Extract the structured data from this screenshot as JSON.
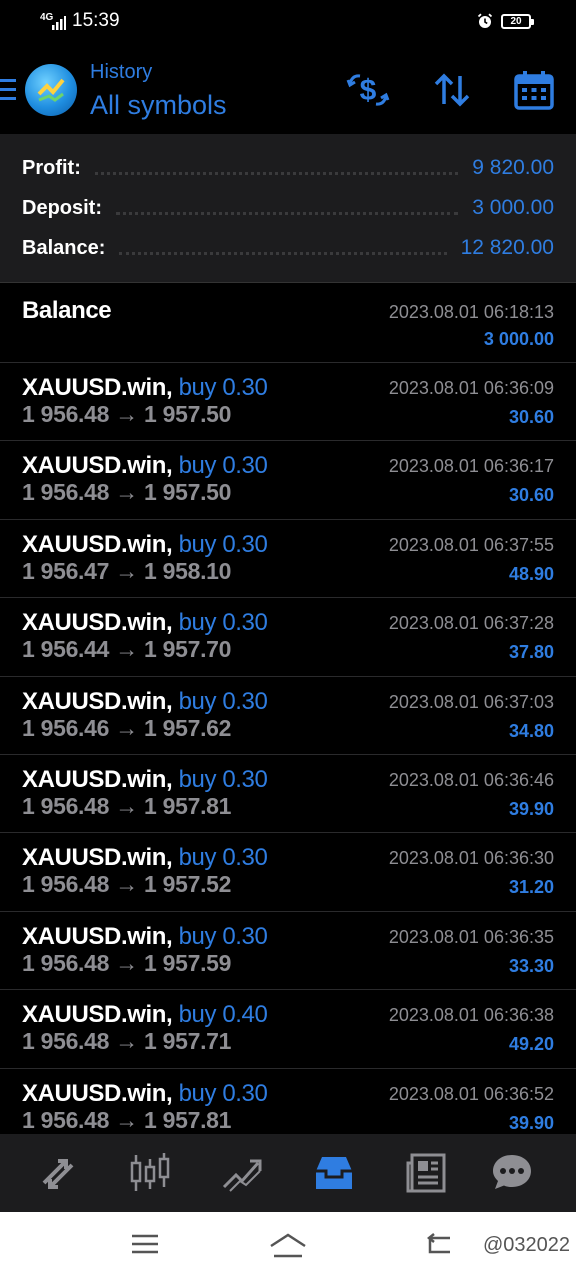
{
  "status_bar": {
    "network": "4G",
    "time": "15:39",
    "battery": "20"
  },
  "header": {
    "subtitle": "History",
    "title": "All symbols",
    "icons": [
      "menu-icon",
      "currency-exchange-icon",
      "sort-icon",
      "calendar-icon"
    ]
  },
  "summary": {
    "profit_label": "Profit:",
    "profit_value": "9 820.00",
    "deposit_label": "Deposit:",
    "deposit_value": "3 000.00",
    "balance_label": "Balance:",
    "balance_value": "12 820.00"
  },
  "balance_entry": {
    "label": "Balance",
    "datetime": "2023.08.01 06:18:13",
    "amount": "3 000.00"
  },
  "trades": [
    {
      "symbol": "XAUUSD.win,",
      "type": "buy 0.30",
      "prices": "1 956.48 → 1 957.50",
      "datetime": "2023.08.01 06:36:09",
      "profit": "30.60"
    },
    {
      "symbol": "XAUUSD.win,",
      "type": "buy 0.30",
      "prices": "1 956.48 → 1 957.50",
      "datetime": "2023.08.01 06:36:17",
      "profit": "30.60"
    },
    {
      "symbol": "XAUUSD.win,",
      "type": "buy 0.30",
      "prices": "1 956.47 → 1 958.10",
      "datetime": "2023.08.01 06:37:55",
      "profit": "48.90"
    },
    {
      "symbol": "XAUUSD.win,",
      "type": "buy 0.30",
      "prices": "1 956.44 → 1 957.70",
      "datetime": "2023.08.01 06:37:28",
      "profit": "37.80"
    },
    {
      "symbol": "XAUUSD.win,",
      "type": "buy 0.30",
      "prices": "1 956.46 → 1 957.62",
      "datetime": "2023.08.01 06:37:03",
      "profit": "34.80"
    },
    {
      "symbol": "XAUUSD.win,",
      "type": "buy 0.30",
      "prices": "1 956.48 → 1 957.81",
      "datetime": "2023.08.01 06:36:46",
      "profit": "39.90"
    },
    {
      "symbol": "XAUUSD.win,",
      "type": "buy 0.30",
      "prices": "1 956.48 → 1 957.52",
      "datetime": "2023.08.01 06:36:30",
      "profit": "31.20"
    },
    {
      "symbol": "XAUUSD.win,",
      "type": "buy 0.30",
      "prices": "1 956.48 → 1 957.59",
      "datetime": "2023.08.01 06:36:35",
      "profit": "33.30"
    },
    {
      "symbol": "XAUUSD.win,",
      "type": "buy 0.40",
      "prices": "1 956.48 → 1 957.71",
      "datetime": "2023.08.01 06:36:38",
      "profit": "49.20"
    },
    {
      "symbol": "XAUUSD.win,",
      "type": "buy 0.30",
      "prices": "1 956.48 → 1 957.81",
      "datetime": "2023.08.01 06:36:52",
      "profit": "39.90"
    }
  ],
  "bottom_nav": {
    "items": [
      "quotes-icon",
      "chart-icon",
      "trade-icon",
      "history-icon",
      "news-icon",
      "messages-icon"
    ],
    "active": "history-icon"
  },
  "system_nav": {
    "watermark": "@032022"
  },
  "colors": {
    "accent": "#2f7de1",
    "background": "#000000",
    "panel": "#1c1c1e",
    "muted_text": "#8e8e93"
  }
}
